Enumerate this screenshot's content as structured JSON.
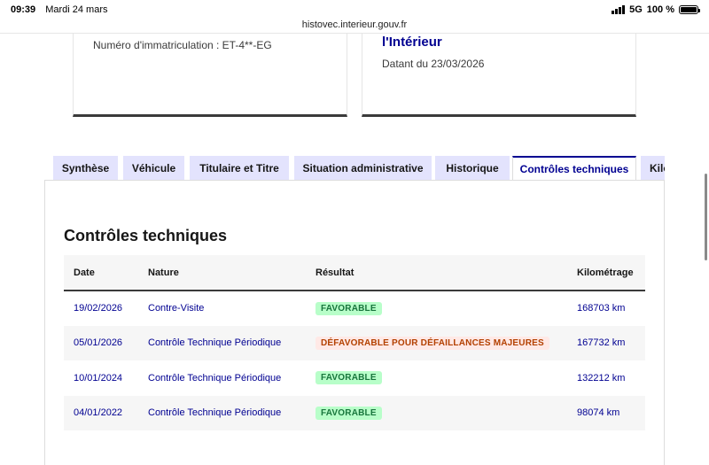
{
  "status_bar": {
    "time": "09:39",
    "date": "Mardi 24 mars",
    "network": "5G",
    "battery": "100 %",
    "battery_level": 1.0
  },
  "browser": {
    "url": "histovec.interieur.gouv.fr"
  },
  "cards": {
    "plate_text": "Numéro d'immatriculation : ET-4**-EG",
    "source_title": "l'Intérieur",
    "dated_text": "Datant du 23/03/2026"
  },
  "tabs": [
    {
      "label": "Synthèse",
      "active": false
    },
    {
      "label": "Véhicule",
      "active": false
    },
    {
      "label": "Titulaire et Titre",
      "active": false
    },
    {
      "label": "Situation administrative",
      "active": false
    },
    {
      "label": "Historique",
      "active": false
    },
    {
      "label": "Contrôles techniques",
      "active": true
    },
    {
      "label": "Kilométrage",
      "active": false
    }
  ],
  "section": {
    "title": "Contrôles techniques"
  },
  "table": {
    "headers": {
      "date": "Date",
      "nature": "Nature",
      "result": "Résultat",
      "mileage": "Kilométrage"
    },
    "rows": [
      {
        "date": "19/02/2026",
        "nature": "Contre-Visite",
        "result": "FAVORABLE",
        "status": "ok",
        "mileage": "168703 km"
      },
      {
        "date": "05/01/2026",
        "nature": "Contrôle Technique Périodique",
        "result": "DÉFAVORABLE POUR DÉFAILLANCES MAJEURES",
        "status": "ko",
        "mileage": "167732 km"
      },
      {
        "date": "10/01/2024",
        "nature": "Contrôle Technique Périodique",
        "result": "FAVORABLE",
        "status": "ok",
        "mileage": "132212 km"
      },
      {
        "date": "04/01/2022",
        "nature": "Contrôle Technique Périodique",
        "result": "FAVORABLE",
        "status": "ok",
        "mileage": "98074 km"
      }
    ]
  },
  "colors": {
    "primary": "#000091",
    "tab_bg": "#e3e3fd",
    "success_bg": "#b8fec9",
    "success_text": "#18753c",
    "error_bg": "#ffe9e6",
    "error_text": "#b34000"
  }
}
